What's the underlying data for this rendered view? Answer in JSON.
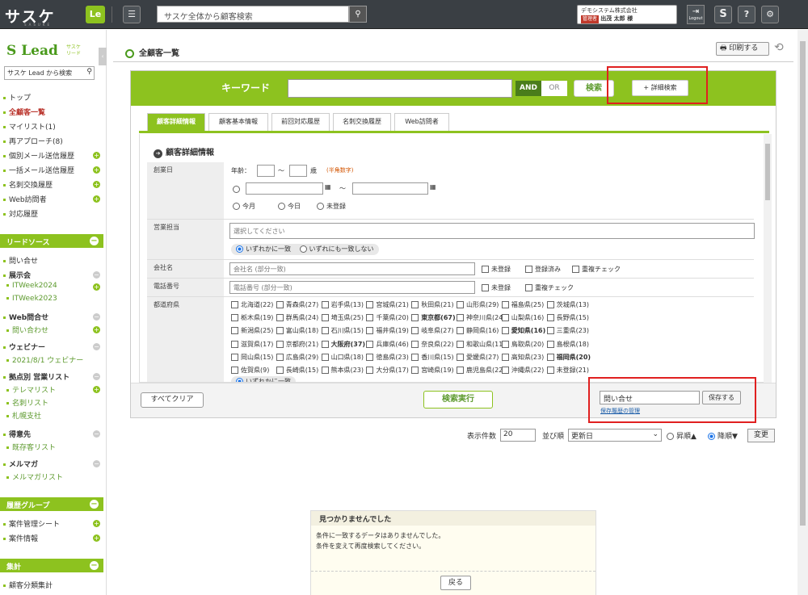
{
  "header": {
    "logo": "サスケ",
    "logo_sub": "SASUKE",
    "le": "Le",
    "search_placeholder": "サスケ全体から顧客検索",
    "company": "デモシステム株式会社",
    "role": "管理者",
    "user": "出茂 太郎 様",
    "logout": "Logout",
    "help": "?"
  },
  "sidebar": {
    "logo": "Lead",
    "logo_sub1": "サスケ",
    "logo_sub2": "リード",
    "search_placeholder": "サスケ Lead から検索",
    "items": [
      "トップ",
      "全顧客一覧",
      "マイリスト(1)",
      "再アプローチ(8)",
      "個別メール送信履歴",
      "一括メール送信履歴",
      "名刺交換履歴",
      "Web訪問者",
      "対応履歴"
    ],
    "sec1": "リードソース",
    "sec1_items": [
      "問い合せ",
      "展示会",
      "ITWeek2024",
      "ITWeek2023",
      "Web問合せ",
      "問い合わせ",
      "ウェビナー",
      "2021/8/1 ウェビナー",
      "拠点別 営業リスト",
      "テレマリスト",
      "名刺リスト",
      "札幌支社",
      "得意先",
      "既存客リスト",
      "メルマガ",
      "メルマガリスト"
    ],
    "sec2": "履歴グループ",
    "sec2_items": [
      "案件管理シート",
      "案件情報"
    ],
    "sec3": "集計",
    "sec3_items": [
      "顧客分類集計"
    ]
  },
  "main": {
    "title": "全顧客一覧",
    "print": "印刷する"
  },
  "search": {
    "keyword": "キーワード",
    "and": "AND",
    "or": "OR",
    "search": "検索",
    "detail": "+ 詳細検索",
    "tabs": [
      "顧客詳細情報",
      "顧客基本情報",
      "前回対応履歴",
      "名刺交換履歴",
      "Web訪問者"
    ],
    "section": "顧客詳細情報",
    "founding": {
      "label": "創業日",
      "age": "年齢：",
      "tilde": "〜",
      "sai": "歳",
      "hint": "(半角数字)",
      "opts": [
        "今月",
        "今日",
        "未登録"
      ]
    },
    "sales": {
      "label": "営業担当",
      "placeholder": "選択してください",
      "any": "いずれかに一致",
      "none": "いずれにも一致しない"
    },
    "company": {
      "label": "会社名",
      "placeholder": "会社名 (部分一致)",
      "opts": [
        "未登録",
        "登録済み",
        "重複チェック"
      ]
    },
    "phone": {
      "label": "電話番号",
      "placeholder": "電話番号 (部分一致)",
      "opts": [
        "未登録",
        "重複チェック"
      ]
    },
    "pref": {
      "label": "都道府県",
      "list": [
        "北海道(22)",
        "青森県(27)",
        "岩手県(13)",
        "宮城県(21)",
        "秋田県(21)",
        "山形県(29)",
        "福島県(25)",
        "茨城県(13)",
        "栃木県(19)",
        "群馬県(24)",
        "埼玉県(25)",
        "千葉県(20)",
        "東京都(67)",
        "神奈川県(24)",
        "山梨県(16)",
        "長野県(15)",
        "新潟県(25)",
        "富山県(18)",
        "石川県(15)",
        "福井県(19)",
        "岐阜県(27)",
        "静岡県(16)",
        "愛知県(16)",
        "三重県(23)",
        "滋賀県(17)",
        "京都府(21)",
        "大阪府(37)",
        "兵庫県(46)",
        "奈良県(22)",
        "和歌山県(11)",
        "鳥取県(20)",
        "島根県(18)",
        "岡山県(15)",
        "広島県(29)",
        "山口県(18)",
        "徳島県(23)",
        "香川県(15)",
        "愛媛県(27)",
        "高知県(23)",
        "福岡県(20)",
        "佐賀県(9)",
        "長崎県(15)",
        "熊本県(23)",
        "大分県(17)",
        "宮崎県(19)",
        "鹿児島県(22)",
        "沖縄県(22)",
        "未登録(21)"
      ],
      "bold": [
        "東京都(67)",
        "愛知県(16)",
        "大阪府(37)",
        "福岡県(20)"
      ]
    },
    "clear": "すべてクリア",
    "exec": "検索実行",
    "save_value": "問い合せ",
    "save": "保存する",
    "save_link": "保存履歴の管理"
  },
  "list": {
    "count_label": "表示件数",
    "count": "20",
    "sort_label": "並び順",
    "sort": "更新日",
    "asc": "昇順▲",
    "desc": "降順▼",
    "change": "変更"
  },
  "notfound": {
    "title": "見つかりませんでした",
    "line1": "条件に一致するデータはありませんでした。",
    "line2": "条件を変えて再度検索してください。",
    "back": "戻る"
  }
}
